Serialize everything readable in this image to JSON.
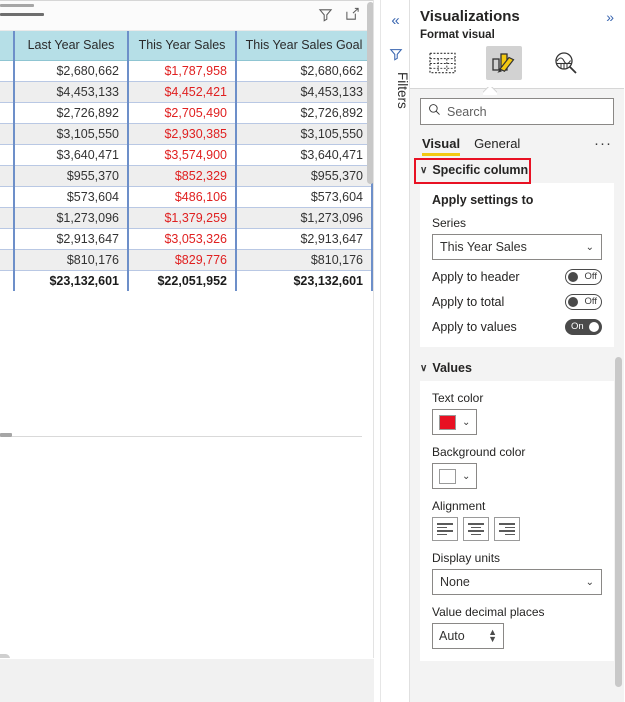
{
  "canvas": {
    "toolbar": {
      "filter_icon": "filter-icon",
      "focus_icon": "focus-mode-icon"
    },
    "table": {
      "columns": [
        "",
        "Last Year Sales",
        "This Year Sales",
        "This Year Sales Goal"
      ],
      "rows": [
        {
          "stub": "",
          "last_year": "$2,680,662",
          "this_year": "$1,787,958",
          "goal": "$2,680,662"
        },
        {
          "stub": "",
          "last_year": "$4,453,133",
          "this_year": "$4,452,421",
          "goal": "$4,453,133"
        },
        {
          "stub": "",
          "last_year": "$2,726,892",
          "this_year": "$2,705,490",
          "goal": "$2,726,892"
        },
        {
          "stub": "",
          "last_year": "$3,105,550",
          "this_year": "$2,930,385",
          "goal": "$3,105,550"
        },
        {
          "stub": "",
          "last_year": "$3,640,471",
          "this_year": "$3,574,900",
          "goal": "$3,640,471"
        },
        {
          "stub": "",
          "last_year": "$955,370",
          "this_year": "$852,329",
          "goal": "$955,370"
        },
        {
          "stub": "",
          "last_year": "$573,604",
          "this_year": "$486,106",
          "goal": "$573,604"
        },
        {
          "stub": "",
          "last_year": "$1,273,096",
          "this_year": "$1,379,259",
          "goal": "$1,273,096"
        },
        {
          "stub": "",
          "last_year": "$2,913,647",
          "this_year": "$3,053,326",
          "goal": "$2,913,647"
        },
        {
          "stub": "",
          "last_year": "$810,176",
          "this_year": "$829,776",
          "goal": "$810,176"
        }
      ],
      "total": {
        "stub": "",
        "last_year": "$23,132,601",
        "this_year": "$22,051,952",
        "goal": "$23,132,601"
      },
      "header_bg": "#b6dfe7",
      "value_text_color": "#e02020"
    }
  },
  "filters_rail": {
    "collapse_icon": "chevron-double-left-icon",
    "filter_icon": "filter-icon",
    "label": "Filters"
  },
  "visualizations": {
    "title": "Visualizations",
    "expand_icon": "chevron-double-right-icon",
    "subtitle": "Format visual",
    "tab_icons": [
      {
        "name": "build-visual-icon",
        "label": "Build visual",
        "active": false
      },
      {
        "name": "format-visual-icon",
        "label": "Format visual",
        "active": true
      },
      {
        "name": "analytics-icon",
        "label": "Analytics",
        "active": false
      }
    ],
    "search": {
      "placeholder": "Search",
      "value": "",
      "icon": "search-icon"
    },
    "tabs": [
      {
        "label": "Visual",
        "active": true
      },
      {
        "label": "General",
        "active": false
      }
    ],
    "more_label": "···",
    "accent_color": "#f2c811",
    "highlight_color": "#e81123"
  },
  "specific_column": {
    "header": "Specific column",
    "chevron": "∨",
    "highlighted": true,
    "apply_settings_to": "Apply settings to",
    "series_label": "Series",
    "series_value": "This Year Sales",
    "toggles": [
      {
        "label": "Apply to header",
        "state": "Off",
        "on": false
      },
      {
        "label": "Apply to total",
        "state": "Off",
        "on": false
      },
      {
        "label": "Apply to values",
        "state": "On",
        "on": true
      }
    ]
  },
  "values_section": {
    "header": "Values",
    "chevron": "∨",
    "text_color_label": "Text color",
    "text_color_value": "#e81123",
    "background_color_label": "Background color",
    "background_color_value": "#ffffff",
    "alignment_label": "Alignment",
    "alignment_options": [
      "align-left",
      "align-center",
      "align-right"
    ],
    "display_units_label": "Display units",
    "display_units_value": "None",
    "decimal_places_label": "Value decimal places",
    "decimal_places_value": "Auto"
  }
}
